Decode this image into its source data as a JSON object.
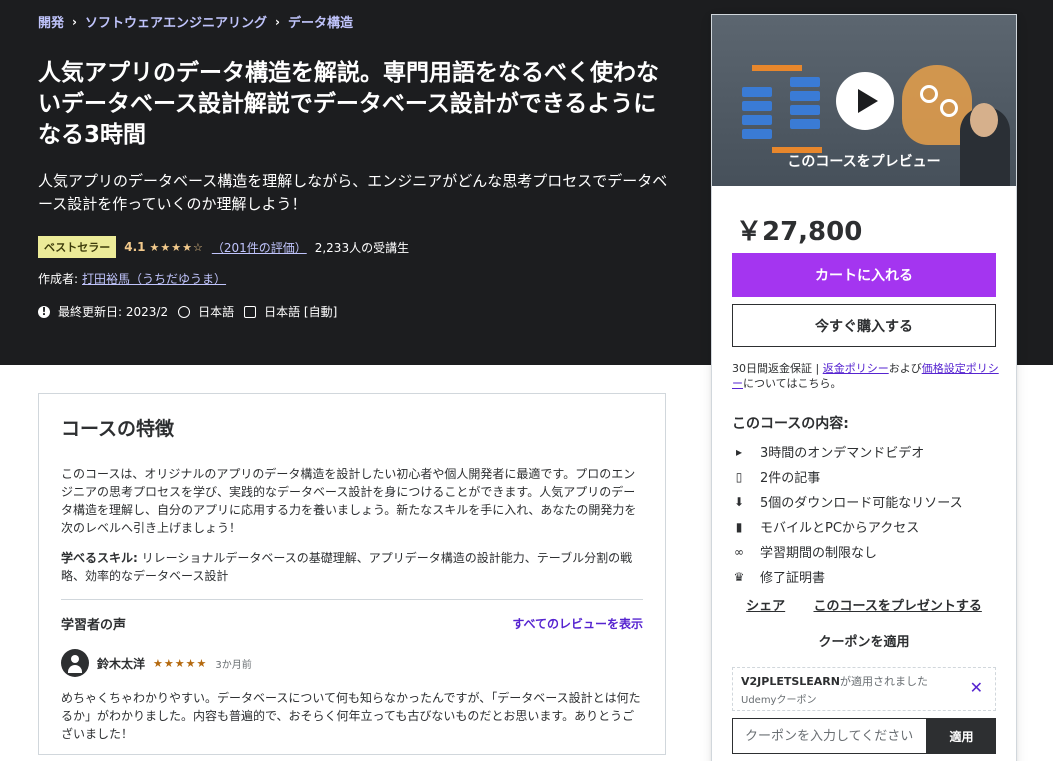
{
  "breadcrumb": [
    "開発",
    "ソフトウェアエンジニアリング",
    "データ構造"
  ],
  "course": {
    "title": "人気アプリのデータ構造を解説。専門用語をなるべく使わないデータベース設計解説でデータベース設計ができるようになる3時間",
    "subtitle": "人気アプリのデータベース構造を理解しながら、エンジニアがどんな思考プロセスでデータベース設計を作っていくのか理解しよう！",
    "badge": "ベストセラー",
    "rating": "4.1",
    "stars": "★★★★☆",
    "rating_count": "（201件の評価）",
    "students": "2,233人の受講生",
    "author_label": "作成者:",
    "author": "打田裕馬（うちだゆうま）",
    "updated": "最終更新日: 2023/2",
    "language": "日本語",
    "captions": "日本語 [自動]"
  },
  "sidebar": {
    "preview_label": "このコースをプレビュー",
    "price": "￥27,800",
    "add_to_cart": "カートに入れる",
    "buy_now": "今すぐ購入する",
    "refund_prefix": "30日間返金保証 | ",
    "refund_link": "返金ポリシー",
    "refund_mid": "および",
    "pricing_link": "価格設定ポリシー",
    "refund_suffix": "についてはこちら。",
    "includes_title": "このコースの内容:",
    "includes": [
      {
        "icon": "video-icon",
        "glyph": "▸",
        "label": "3時間のオンデマンドビデオ"
      },
      {
        "icon": "file-icon",
        "glyph": "▯",
        "label": "2件の記事"
      },
      {
        "icon": "download-icon",
        "glyph": "⬇",
        "label": "5個のダウンロード可能なリソース"
      },
      {
        "icon": "mobile-icon",
        "glyph": "▮",
        "label": "モバイルとPCからアクセス"
      },
      {
        "icon": "infinity-icon",
        "glyph": "∞",
        "label": "学習期間の制限なし"
      },
      {
        "icon": "trophy-icon",
        "glyph": "♛",
        "label": "修了証明書"
      }
    ],
    "share": "シェア",
    "gift": "このコースをプレゼントする",
    "apply_coupon": "クーポンを適用",
    "coupon_code": "V2JPLETSLEARN",
    "coupon_applied": "が適用されました",
    "coupon_sub": "Udemyクーポン",
    "coupon_placeholder": "クーポンを入力してください",
    "apply_button": "適用"
  },
  "features": {
    "title": "コースの特徴",
    "description": "このコースは、オリジナルのアプリのデータ構造を設計したい初心者や個人開発者に最適です。プロのエンジニアの思考プロセスを学び、実践的なデータベース設計を身につけることができます。人気アプリのデータ構造を理解し、自分のアプリに応用する力を養いましょう。新たなスキルを手に入れ、あなたの開発力を次のレベルへ引き上げましょう！",
    "skills_label": "学べるスキル:",
    "skills": " リレーショナルデータベースの基礎理解、アプリデータ構造の設計能力、テーブル分割の戦略、効率的なデータベース設計",
    "voice_title": "学習者の声",
    "all_reviews": "すべてのレビューを表示",
    "review": {
      "name": "鈴木太洋",
      "stars": "★★★★★",
      "time": "3か月前",
      "text": "めちゃくちゃわかりやすい。データベースについて何も知らなかったんですが、「データベース設計とは何たるか」がわかりました。内容も普遍的で、おそらく何年立っても古びないものだとお思います。ありとうございました！"
    }
  }
}
